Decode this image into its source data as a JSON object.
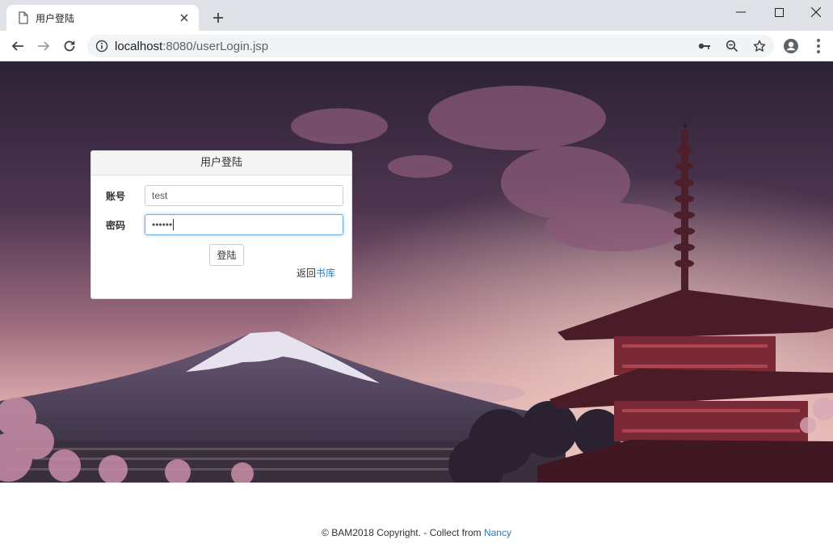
{
  "browser": {
    "tab_title": "用户登陆",
    "url_host": "localhost",
    "url_rest": ":8080/userLogin.jsp"
  },
  "login": {
    "heading": "用户登陆",
    "account_label": "账号",
    "account_value": "test",
    "password_label": "密码",
    "password_value": "••••••",
    "submit_label": "登陆",
    "back_prefix": "返回",
    "back_link": "书库"
  },
  "footer": {
    "copyright": "© BAM2018 Copyright. - Collect from ",
    "author_link": "Nancy"
  },
  "colors": {
    "link": "#337ab7",
    "focus": "#66afe9"
  }
}
